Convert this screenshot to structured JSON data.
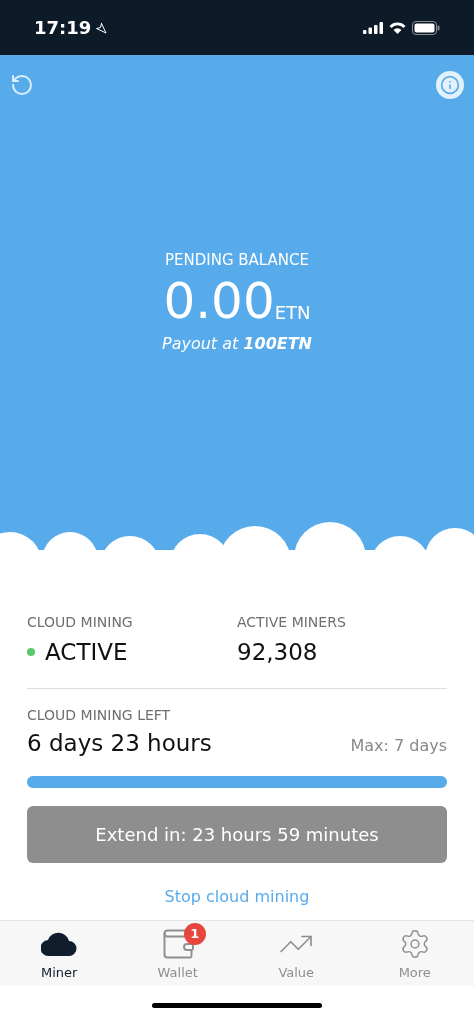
{
  "status_bar": {
    "time": "17:19"
  },
  "balance": {
    "label": "PENDING BALANCE",
    "amount": "0.00",
    "unit": "ETN",
    "payout": "Payout at **100ETN**"
  },
  "stats": [
    {
      "label": "CLOUD MINING",
      "value": "ACTIVE",
      "color": "#5cc86a"
    },
    {
      "label": "ACTIVE MINERS",
      "value": "92,308"
    }
  ],
  "mining_left": {
    "label": "CLOUD MINING LEFT",
    "value": "6 days 23 hours",
    "max": "Max: 7 days",
    "level": 1
  },
  "extend_button": {
    "label": "Extend in: 23 hours 59 minutes",
    "disabled": true
  },
  "stop_link": "Stop cloud mining",
  "tab_bar": [
    {
      "kind": "cloud",
      "label": "Miner",
      "selected": true
    },
    {
      "kind": "wallet",
      "label": "Wallet",
      "selected": false,
      "badge": "1"
    },
    {
      "kind": "chart",
      "label": "Value",
      "selected": false
    },
    {
      "kind": "gear",
      "label": "More",
      "selected": false
    }
  ]
}
